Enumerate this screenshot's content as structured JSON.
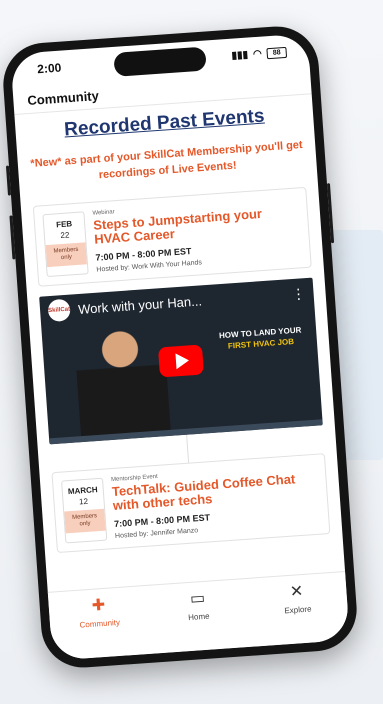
{
  "status_bar": {
    "time": "2:00",
    "battery": "88"
  },
  "header": {
    "title": "Community"
  },
  "page": {
    "title": "Recorded Past Events",
    "promo": "*New* as part of your SkillCat Membership you'll get recordings of Live Events!"
  },
  "events": [
    {
      "type": "Webinar",
      "month": "FEB",
      "day": "22",
      "tag": "Members only",
      "title": "Steps to Jumpstarting your HVAC Career",
      "time": "7:00 PM - 8:00 PM EST",
      "host": "Hosted by: Work With Your Hands"
    },
    {
      "type": "Mentorship Event",
      "month": "MARCH",
      "day": "12",
      "tag": "Members only",
      "title": "TechTalk: Guided Coffee Chat with other techs",
      "time": "7:00 PM - 8:00 PM EST",
      "host": "Hosted by: Jennifer Manzo"
    }
  ],
  "video": {
    "title": "Work with your Han...",
    "channel_logo": "SkillCat",
    "thumb_line1": "HOW TO LAND YOUR",
    "thumb_line2": "FIRST HVAC JOB"
  },
  "tabs": [
    {
      "label": "Community",
      "icon": "community-icon",
      "active": true
    },
    {
      "label": "Home",
      "icon": "book-icon",
      "active": false
    },
    {
      "label": "Explore",
      "icon": "tools-icon",
      "active": false
    }
  ],
  "colors": {
    "accent": "#e4582a",
    "title": "#1f3670",
    "play": "#ff0000"
  }
}
